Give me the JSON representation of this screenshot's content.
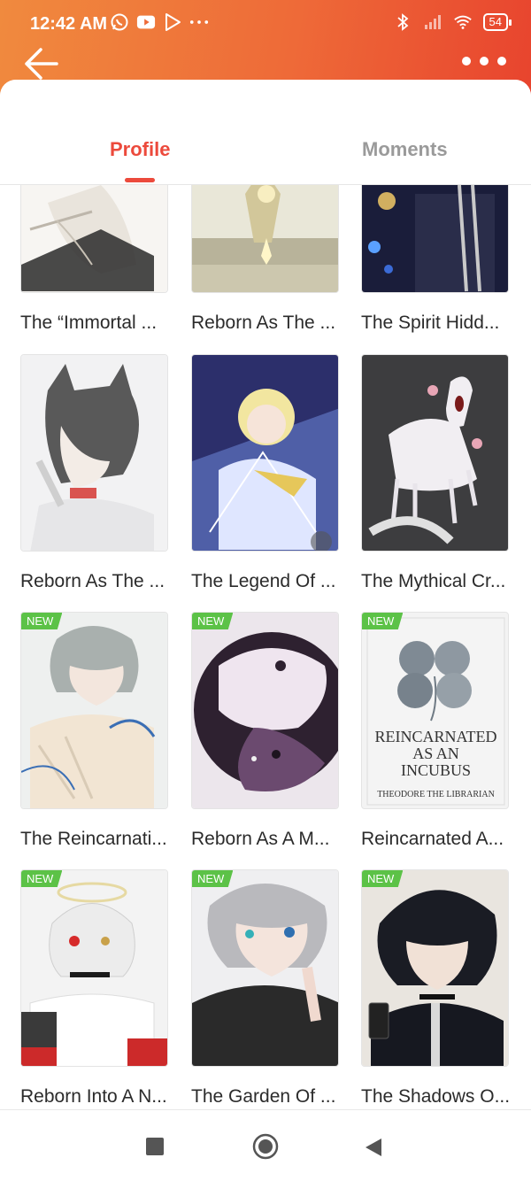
{
  "status_bar": {
    "time": "12:42 AM",
    "battery": "54",
    "icons": [
      "whatsapp-icon",
      "youtube-icon",
      "play-store-icon",
      "more-dots-icon",
      "bluetooth-icon",
      "signal-icon",
      "wifi-icon",
      "battery-icon"
    ]
  },
  "header": {
    "back_icon": "arrow-left-icon",
    "more_icon": "more-horizontal-icon"
  },
  "tabs": [
    {
      "label": "Profile",
      "active": true
    },
    {
      "label": "Moments",
      "active": false
    }
  ],
  "books": [
    {
      "title": "The “Immortal ...",
      "new": false
    },
    {
      "title": "Reborn As The ...",
      "new": false
    },
    {
      "title": "The Spirit Hidd...",
      "new": false
    },
    {
      "title": "Reborn As The ...",
      "new": false
    },
    {
      "title": "The Legend Of ...",
      "new": false
    },
    {
      "title": "The Mythical Cr...",
      "new": false
    },
    {
      "title": "The Reincarnati...",
      "new": true
    },
    {
      "title": "Reborn As A M...",
      "new": true
    },
    {
      "title": "Reincarnated A...",
      "new": true
    },
    {
      "title": "Reborn Into A N...",
      "new": true
    },
    {
      "title": "The Garden Of ...",
      "new": true
    },
    {
      "title": "The Shadows O...",
      "new": true
    }
  ],
  "new_badge_label": "NEW",
  "cover_text": {
    "incubus_title_1": "REINCARNATED",
    "incubus_title_2": "AS AN",
    "incubus_title_3": "INCUBUS",
    "incubus_author": "THEODORE THE LIBRARIAN"
  },
  "system_nav": {
    "recents_icon": "square-icon",
    "home_icon": "circle-icon",
    "back_icon": "triangle-back-icon"
  },
  "colors": {
    "accent": "#ec4a3c",
    "header_start": "#f08a3e",
    "header_end": "#e8442e",
    "new_badge": "#5cc247"
  }
}
